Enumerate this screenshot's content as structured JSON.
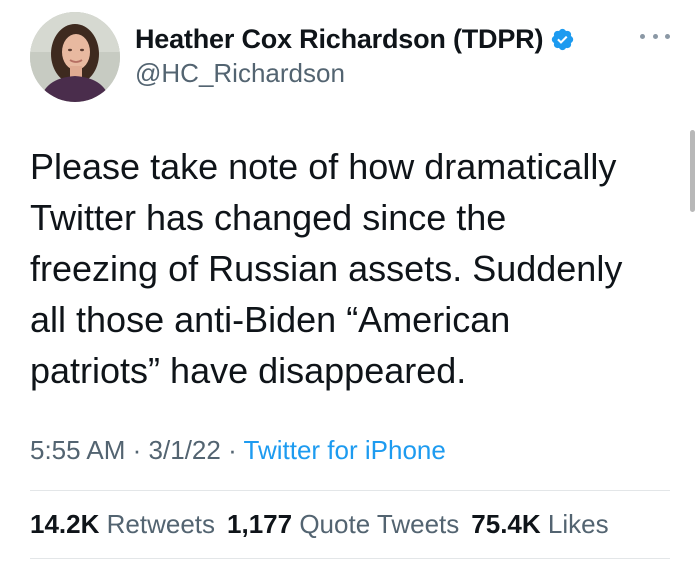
{
  "tweet": {
    "author": {
      "display_name": "Heather Cox Richardson (TDPR)",
      "handle": "@HC_Richardson",
      "verified_icon": "verified-badge-icon",
      "avatar": "profile-photo"
    },
    "more_icon": "more-horizontal-icon",
    "text_lines": [
      "Please take note of how dramatically",
      "Twitter has changed since the",
      "freezing of Russian assets. Suddenly",
      "all those anti-Biden “American",
      "patriots” have disappeared."
    ],
    "time": "5:55 AM",
    "date": "3/1/22",
    "separator": "·",
    "source": "Twitter for iPhone",
    "stats": {
      "retweets_count": "14.2K",
      "retweets_label": "Retweets",
      "quotes_count": "1,177",
      "quotes_label": "Quote Tweets",
      "likes_count": "75.4K",
      "likes_label": "Likes"
    }
  },
  "colors": {
    "text_primary": "#0f1419",
    "text_secondary": "#536471",
    "link": "#1d9bf0",
    "divider": "#e3e6e8"
  }
}
